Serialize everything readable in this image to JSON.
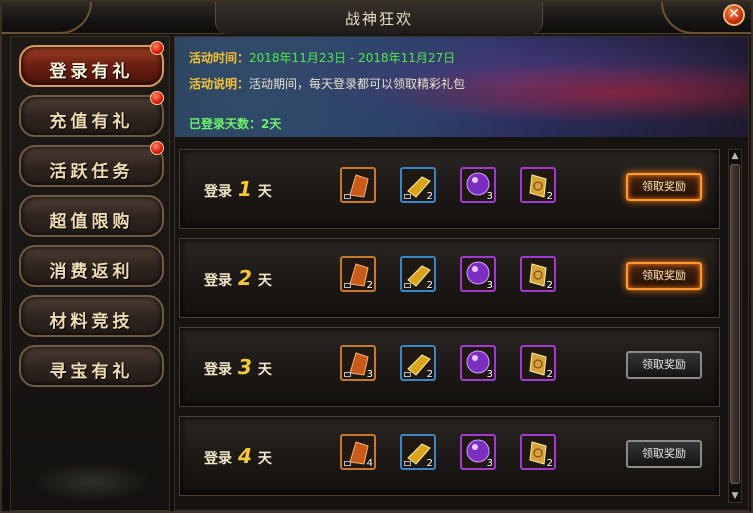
{
  "window": {
    "title": "战神狂欢"
  },
  "sidebar": {
    "items": [
      {
        "label": "登录有礼",
        "active": true,
        "badge": true
      },
      {
        "label": "充值有礼",
        "active": false,
        "badge": true
      },
      {
        "label": "活跃任务",
        "active": false,
        "badge": true
      },
      {
        "label": "超值限购",
        "active": false,
        "badge": false
      },
      {
        "label": "消费返利",
        "active": false,
        "badge": false
      },
      {
        "label": "材料竞技",
        "active": false,
        "badge": false
      },
      {
        "label": "寻宝有礼",
        "active": false,
        "badge": false
      }
    ]
  },
  "banner": {
    "time_key": "活动时间：",
    "time_value": "2018年11月23日 - 2018年11月27日",
    "desc_key": "活动说明：",
    "desc_value": "活动期间，每天登录都可以领取精彩礼包",
    "days_key": "已登录天数：",
    "days_value": "2天"
  },
  "rows": [
    {
      "prefix": "登录",
      "day": "1",
      "suffix": "天",
      "claim": "领取奖励",
      "ready": true,
      "items": [
        {
          "icon": "orange-shard-icon",
          "rarity": "orange",
          "count": ""
        },
        {
          "icon": "gold-bar-icon",
          "rarity": "blue",
          "count": "2"
        },
        {
          "icon": "purple-orb-icon",
          "rarity": "purple",
          "count": "3"
        },
        {
          "icon": "gold-token-icon",
          "rarity": "purple",
          "count": "2"
        }
      ]
    },
    {
      "prefix": "登录",
      "day": "2",
      "suffix": "天",
      "claim": "领取奖励",
      "ready": true,
      "items": [
        {
          "icon": "orange-shard-icon",
          "rarity": "orange",
          "count": "2"
        },
        {
          "icon": "gold-bar-icon",
          "rarity": "blue",
          "count": "2"
        },
        {
          "icon": "purple-orb-icon",
          "rarity": "purple",
          "count": "3"
        },
        {
          "icon": "gold-token-icon",
          "rarity": "purple",
          "count": "2"
        }
      ]
    },
    {
      "prefix": "登录",
      "day": "3",
      "suffix": "天",
      "claim": "领取奖励",
      "ready": false,
      "items": [
        {
          "icon": "orange-shard-icon",
          "rarity": "orange",
          "count": "3"
        },
        {
          "icon": "gold-bar-icon",
          "rarity": "blue",
          "count": "2"
        },
        {
          "icon": "purple-orb-icon",
          "rarity": "purple",
          "count": "3"
        },
        {
          "icon": "gold-token-icon",
          "rarity": "purple",
          "count": "2"
        }
      ]
    },
    {
      "prefix": "登录",
      "day": "4",
      "suffix": "天",
      "claim": "领取奖励",
      "ready": false,
      "items": [
        {
          "icon": "orange-shard-icon",
          "rarity": "orange",
          "count": "4"
        },
        {
          "icon": "gold-bar-icon",
          "rarity": "blue",
          "count": "2"
        },
        {
          "icon": "purple-orb-icon",
          "rarity": "purple",
          "count": "3"
        },
        {
          "icon": "gold-token-icon",
          "rarity": "purple",
          "count": "2"
        }
      ]
    }
  ],
  "colors": {
    "accent": "#f6c838",
    "claim_glow": "#ff9c2a",
    "active_tab": "#6a1f12"
  }
}
